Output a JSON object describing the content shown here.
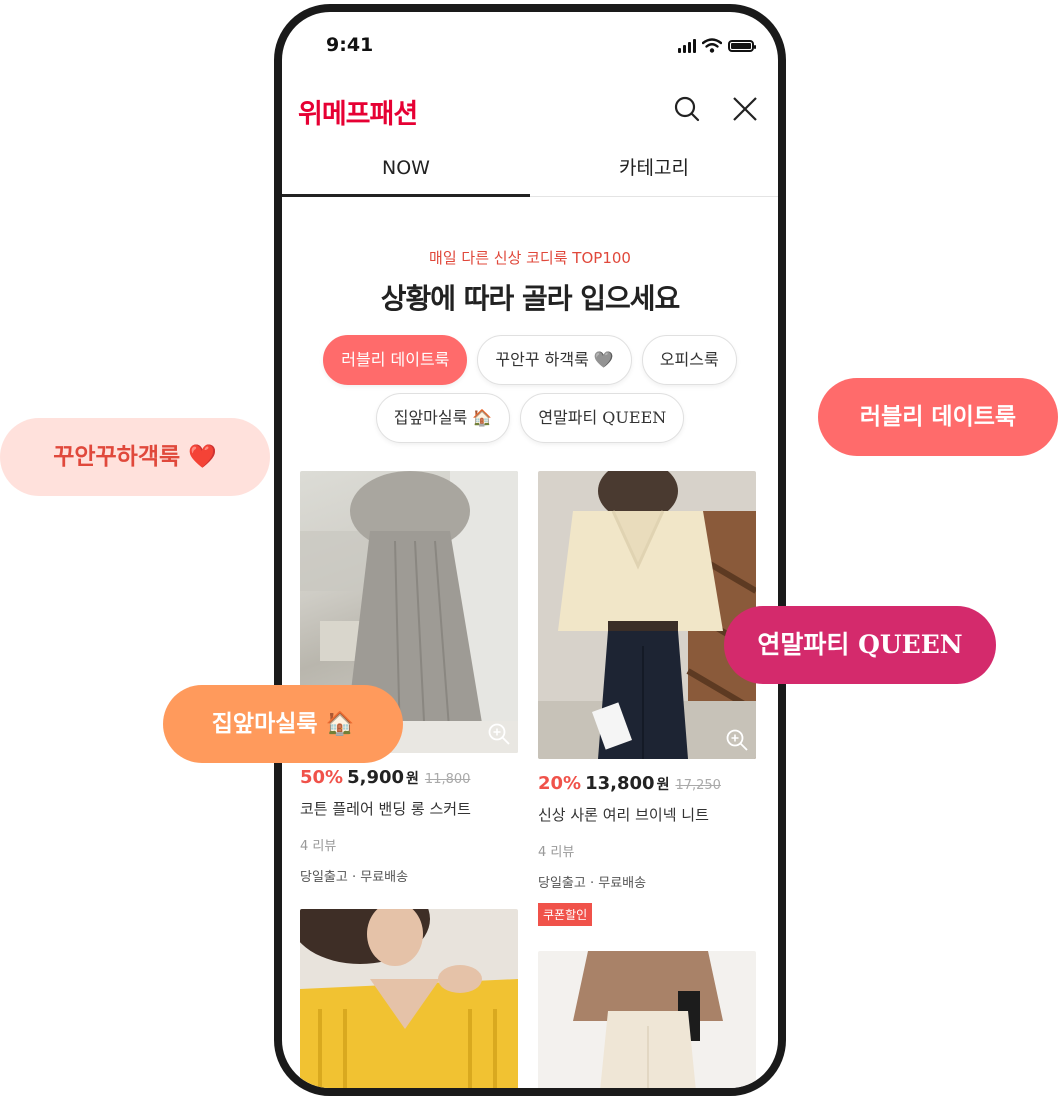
{
  "status_bar": {
    "time": "9:41"
  },
  "header": {
    "brand": "위메프패션",
    "search_icon": "search-icon",
    "close_icon": "close-icon"
  },
  "tabs": [
    {
      "label": "NOW",
      "active": true
    },
    {
      "label": "카테고리",
      "active": false
    }
  ],
  "hero": {
    "subtitle": "매일 다른 신상 코디룩 TOP100",
    "title": "상황에 따라 골라 입으세요"
  },
  "chips": [
    {
      "label": "러블리 데이트룩",
      "active": true
    },
    {
      "label": "꾸안꾸 하객룩 🩶",
      "active": false
    },
    {
      "label": "오피스룩",
      "active": false
    },
    {
      "label": "집앞마실룩 🏠",
      "active": false
    },
    {
      "label": "연말파티 QUEEN",
      "active": false
    }
  ],
  "products": [
    {
      "discount": "50%",
      "price": "5,900",
      "unit": "원",
      "original": "11,800",
      "name": "코튼 플레어 밴딩 롱 스커트",
      "reviews": "4 리뷰",
      "shipping": "당일출고 · 무료배송",
      "coupon": ""
    },
    {
      "discount": "20%",
      "price": "13,800",
      "unit": "원",
      "original": "17,250",
      "name": "신상 사론 여리 브이넥 니트",
      "reviews": "4 리뷰",
      "shipping": "당일출고 · 무료배송",
      "coupon": "쿠폰할인"
    }
  ],
  "callouts": [
    {
      "label": "꾸안꾸하객룩 ❤️"
    },
    {
      "label": "러블리 데이트룩"
    },
    {
      "label": "연말파티 QUEEN"
    },
    {
      "label": "집앞마실룩 🏠"
    }
  ],
  "colors": {
    "brand": "#e60033",
    "accent": "#ff6b6b",
    "discount": "#f0524a",
    "callout_pink": "#ffe1dc",
    "callout_coral": "#ff6b6b",
    "callout_magenta": "#d42a6c",
    "callout_orange": "#ff9a5c"
  }
}
